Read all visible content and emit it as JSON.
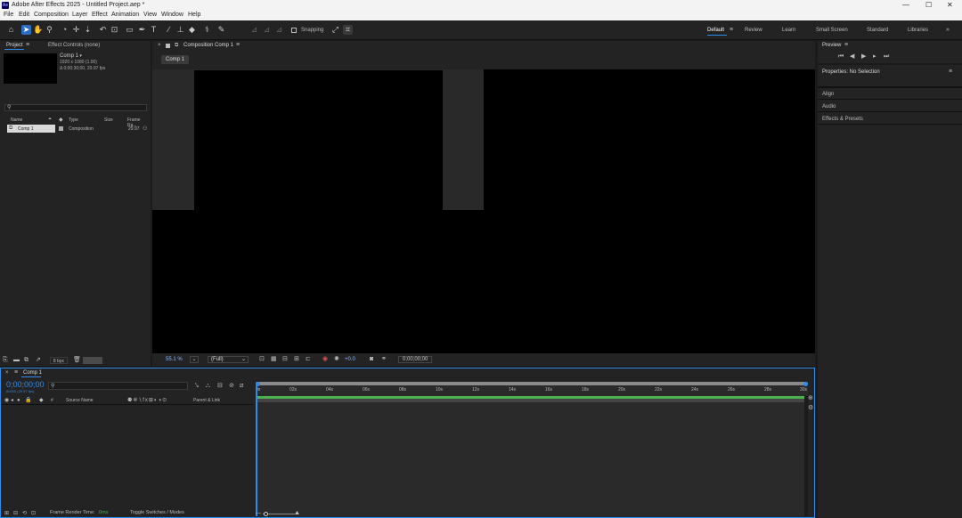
{
  "app": {
    "badge": "Ae",
    "title": "Adobe After Effects 2025 - Untitled Project.aep *"
  },
  "menu": [
    "File",
    "Edit",
    "Composition",
    "Layer",
    "Effect",
    "Animation",
    "View",
    "Window",
    "Help"
  ],
  "toolbar": {
    "snapping_label": "Snapping"
  },
  "workspaces": [
    {
      "label": "Default",
      "active": true
    },
    {
      "label": "Review",
      "active": false
    },
    {
      "label": "Learn",
      "active": false
    },
    {
      "label": "Small Screen",
      "active": false
    },
    {
      "label": "Standard",
      "active": false
    },
    {
      "label": "Libraries",
      "active": false
    }
  ],
  "project": {
    "tab_project": "Project",
    "tab_effect_controls": "Effect Controls (none)",
    "info_name": "Comp 1",
    "info_size": "1920 x 1080 (1.00)",
    "info_duration": "Δ 0;00;30;00, 29.97 fps",
    "search_placeholder": "",
    "col_name": "Name",
    "col_type": "Type",
    "col_size": "Size",
    "col_frame": "Frame Ra...",
    "rows": [
      {
        "name": "Comp 1",
        "type": "Composition",
        "frame": "29.97"
      }
    ],
    "bpc": "8 bpc"
  },
  "composition": {
    "tab_label": "Composition Comp 1",
    "breadcrumb": "Comp 1",
    "zoom": "55.1 %",
    "resolution": "(Full)",
    "exposure": "+0.0",
    "timecode": "0;00;00;00"
  },
  "right": {
    "preview_tab": "Preview",
    "properties": "Properties: No Selection",
    "sections": [
      "Align",
      "Audio",
      "Effects & Presets"
    ]
  },
  "timeline": {
    "tab_label": "Comp 1",
    "timecode": "0;00;00;00",
    "timecode_sub": "00000 (29.97 fps)",
    "col_source": "Source Name",
    "col_parent": "Parent & Link",
    "ruler": [
      "0s",
      "02s",
      "04s",
      "06s",
      "08s",
      "10s",
      "12s",
      "14s",
      "16s",
      "18s",
      "20s",
      "22s",
      "24s",
      "26s",
      "28s",
      "30s"
    ],
    "render_time_label": "Frame Render Time:",
    "render_time_value": "0ms",
    "toggle_label": "Toggle Switches / Modes"
  },
  "colors": {
    "accent": "#2d8ceb",
    "work_bar": "#4caf50",
    "bg": "#1b1b1b",
    "panel": "#232323"
  }
}
